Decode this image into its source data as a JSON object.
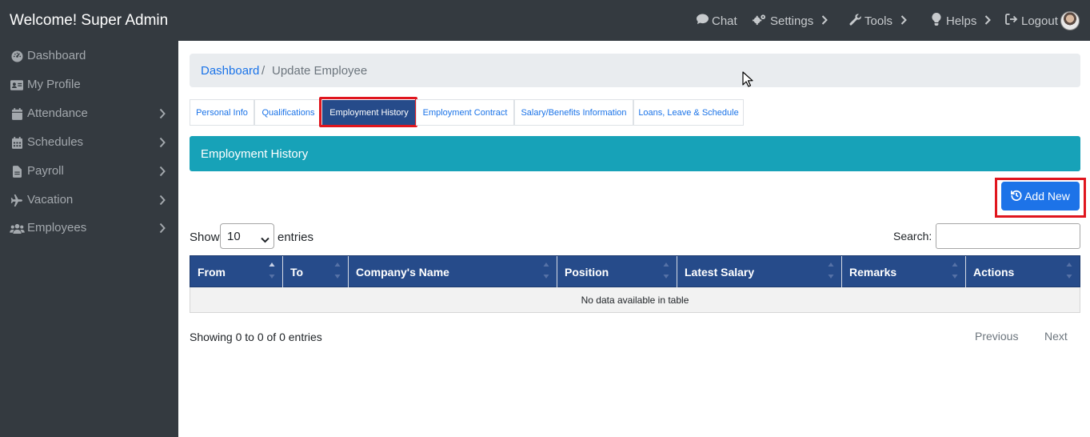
{
  "header": {
    "brand": "Welcome! Super Admin",
    "nav": {
      "chat": "Chat",
      "settings": "Settings",
      "tools": "Tools",
      "helps": "Helps",
      "logout": "Logout"
    }
  },
  "sidebar": {
    "items": [
      {
        "label": "Dashboard",
        "icon": "dashboard-icon",
        "has_children": false
      },
      {
        "label": "My Profile",
        "icon": "id-card-icon",
        "has_children": false
      },
      {
        "label": "Attendance",
        "icon": "calendar-icon",
        "has_children": true
      },
      {
        "label": "Schedules",
        "icon": "calendar-grid-icon",
        "has_children": true
      },
      {
        "label": "Payroll",
        "icon": "file-icon",
        "has_children": true
      },
      {
        "label": "Vacation",
        "icon": "plane-icon",
        "has_children": true
      },
      {
        "label": "Employees",
        "icon": "users-icon",
        "has_children": true
      }
    ]
  },
  "breadcrumb": {
    "link": "Dashboard",
    "separator": "/",
    "current": "Update Employee"
  },
  "tabs": [
    {
      "label": "Personal Info",
      "active": false
    },
    {
      "label": "Qualifications",
      "active": false
    },
    {
      "label": "Employment History",
      "active": true
    },
    {
      "label": "Employment Contract",
      "active": false
    },
    {
      "label": "Salary/Benefits Information",
      "active": false
    },
    {
      "label": "Loans, Leave & Schedule",
      "active": false
    }
  ],
  "section": {
    "title": "Employment History",
    "add_button": "Add New"
  },
  "table_controls": {
    "show_label": "Show",
    "length_value": "10",
    "entries_label": "entries",
    "search_label": "Search:",
    "search_value": ""
  },
  "table": {
    "columns": [
      "From",
      "To",
      "Company's Name",
      "Position",
      "Latest Salary",
      "Remarks",
      "Actions"
    ],
    "empty_message": "No data available in table"
  },
  "footer": {
    "info": "Showing 0 to 0 of 0 entries",
    "previous": "Previous",
    "next": "Next"
  },
  "colors": {
    "navbar_bg": "#343a40",
    "active_tab_bg": "#264b8a",
    "section_header_bg": "#17a2b8",
    "primary_button": "#1d73e8",
    "highlight_border": "#e0161e"
  }
}
